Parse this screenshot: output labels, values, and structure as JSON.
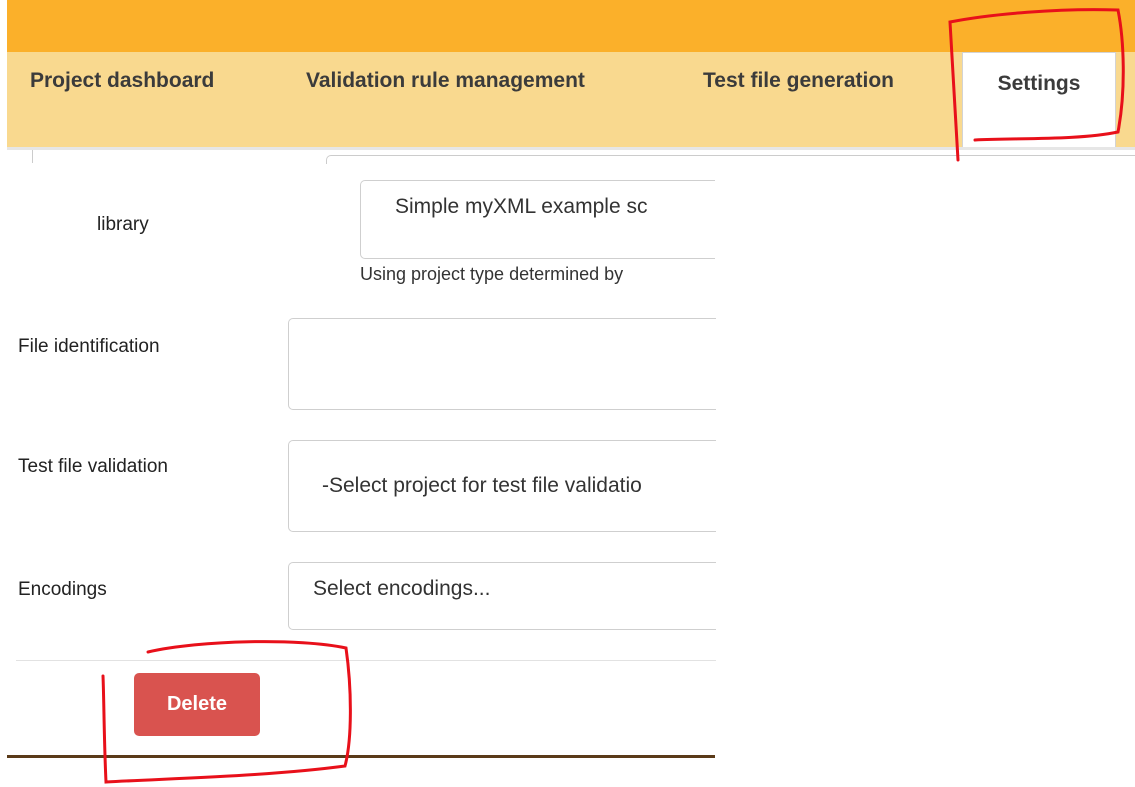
{
  "nav": {
    "tabs": [
      {
        "label": "Project dashboard"
      },
      {
        "label": "Validation rule management"
      },
      {
        "label": "Test file generation"
      },
      {
        "label": "Settings",
        "active": true
      }
    ]
  },
  "form": {
    "library": {
      "label": "library",
      "value": "Simple myXML example sc",
      "help": "Using project type determined by"
    },
    "file_identification": {
      "label": "File identification",
      "value": ""
    },
    "test_file_validation": {
      "label": "Test file validation",
      "value": "-Select project for test file validatio"
    },
    "encodings": {
      "label": "Encodings",
      "placeholder": "Select encodings..."
    }
  },
  "actions": {
    "delete_label": "Delete"
  },
  "colors": {
    "header": "#fbb02a",
    "tabbar": "#f9d98f",
    "danger": "#d9534f",
    "annotation": "#e8101a"
  }
}
